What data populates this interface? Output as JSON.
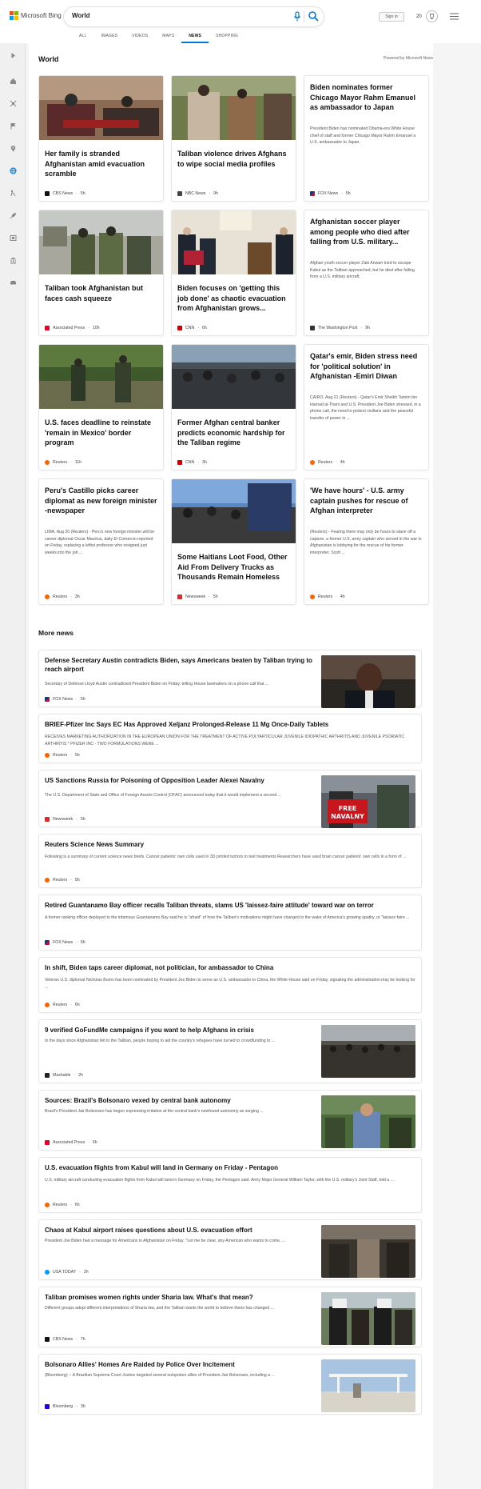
{
  "header": {
    "logo_text": "Microsoft Bing",
    "search_value": "World",
    "tabs": [
      "ALL",
      "IMAGES",
      "VIDEOS",
      "MAPS",
      "NEWS",
      "SHOPPING"
    ],
    "active_tab": "NEWS",
    "signin_label": "Sign in",
    "rewards_count": "20"
  },
  "section": {
    "title": "World",
    "powered_by": "Powered by Microsoft News"
  },
  "cards": [
    {
      "title": "Her family is stranded Afghanistan amid evacuation scramble",
      "source": "CBS News",
      "time": "5h",
      "has_image": true
    },
    {
      "title": "Taliban violence drives Afghans to wipe social media profiles",
      "source": "NBC News",
      "time": "9h",
      "has_image": true
    },
    {
      "title": "Biden nominates former Chicago Mayor Rahm Emanuel as ambassador to Japan",
      "desc": "President Biden has nominated Obama-era White House chief of staff and former Chicago Mayor Rahm Emanuel a U.S. ambassador to Japan.",
      "source": "FOX News",
      "time": "5h",
      "has_image": false
    },
    {
      "title": "Taliban took Afghanistan but faces cash squeeze",
      "source": "Associated Press",
      "time": "10h",
      "has_image": true
    },
    {
      "title": "Biden focuses on 'getting this job done' as chaotic evacuation from Afghanistan grows...",
      "source": "CNN",
      "time": "6h",
      "has_image": true
    },
    {
      "title": "Afghanistan soccer player among people who died after falling from U.S. military...",
      "desc": "Afghan youth soccer player Zaki Anwari tried to escape Kabul as the Taliban approached, but he died after falling from a U.S. military aircraft.",
      "source": "The Washington Post",
      "time": "9h",
      "has_image": false
    },
    {
      "title": "U.S. faces deadline to reinstate 'remain in Mexico' border program",
      "source": "Reuters",
      "time": "11h",
      "has_image": true
    },
    {
      "title": "Former Afghan central banker predicts economic hardship for the Taliban regime",
      "source": "CNN",
      "time": "3h",
      "has_image": true
    },
    {
      "title": "Qatar's emir, Biden stress need for 'political solution' in Afghanistan -Emiri Diwan",
      "desc": "CAIRO, Aug 21 (Reuters) - Qatar's Emir Sheikh Tamim bin Hamad al-Thani and U.S. President Joe Biden stressed, in a phone call, the need to protect civilians and the peaceful transfer of power in ...",
      "source": "Reuters",
      "time": "4h",
      "has_image": false
    },
    {
      "title": "Peru's Castillo picks career diplomat as new foreign minister -newspaper",
      "desc": "LIMA, Aug 20 (Reuters) - Peru's new foreign minister will be career diplomat Oscar Maurtua, daily El Comercio reported on Friday, replacing a leftist professor who resigned just weeks into the job ...",
      "source": "Reuters",
      "time": "3h",
      "has_image": false
    },
    {
      "title": "Some Haitians Loot Food, Other Aid From Delivery Trucks as Thousands Remain Homeless",
      "source": "Newsweek",
      "time": "5h",
      "has_image": true
    },
    {
      "title": "'We have hours' - U.S. army captain pushes for rescue of Afghan interpreter",
      "desc": "(Reuters) - Fearing there may only be hours to stave off a capture, a former U.S. army captain who served in the war in Afghanistan is lobbying for the rescue of his former interpreter.     Scott ...",
      "source": "Reuters",
      "time": "4h",
      "has_image": false
    }
  ],
  "more_news": {
    "title": "More news",
    "items": [
      {
        "title": "Defense Secretary Austin contradicts Biden, says Americans beaten by Taliban trying to reach airport",
        "desc": "Secretary of Defense Lloyd Austin contradicted President Biden on Friday, telling House lawmakers on a phone call that ...",
        "source": "FOX News",
        "time": "5h",
        "has_image": true
      },
      {
        "title": "BRIEF-Pfizer Inc Says EC Has Approved Xeljanz Prolonged-Release 11 Mg Once-Daily Tablets",
        "desc": "RECEIVES MARKETING AUTHORIZATION IN THE EUROPEAN UNION FOR THE TREATMENT OF ACTIVE POLYARTICULAR JUVENILE IDIOPATHIC ARTHRITIS AND JUVENILE PSORIATIC ARTHRITIS * PFIZER INC - TWO FORMULATIONS WERE ...",
        "source": "Reuters",
        "time": "5h",
        "has_image": false
      },
      {
        "title": "US Sanctions Russia for Poisoning of Opposition Leader Alexei Navalny",
        "desc": "The U.S. Department of State and Office of Foreign Assets Control (OFAC) announced today that it would implement a second ...",
        "source": "Newsweek",
        "time": "5h",
        "has_image": true,
        "image_text": "FREE NAVALNY"
      },
      {
        "title": "Reuters Science News Summary",
        "desc": "Following is a summary of current science news briefs. Cancer patients' own cells used in 3D printed tumors to test treatments Researchers have used brain cancer patients' own cells in a form of ...",
        "source": "Reuters",
        "time": "5h",
        "has_image": false
      },
      {
        "title": "Retired Guantanamo Bay officer recalls Taliban threats, slams US 'laissez-faire attitude' toward war on terror",
        "desc": "A former ranking officer deployed to the infamous Guantanamo Bay said he is \"afraid\" of how the Taliban's motivations might have changed in the wake of America's growing apathy, or \"laissez-faire ...",
        "source": "FOX News",
        "time": "6h",
        "has_image": false
      },
      {
        "title": "In shift, Biden taps career diplomat, not politician, for ambassador to China",
        "desc": "Veteran U.S. diplomat Nicholas Burns has been nominated by President Joe Biden to serve as U.S. ambassador to China, the White House said on Friday, signaling the administration may be looking for ...",
        "source": "Reuters",
        "time": "6h",
        "has_image": false
      },
      {
        "title": "9 verified GoFundMe campaigns if you want to help Afghans in crisis",
        "desc": "In the days since Afghanistan fell to the Taliban, people hoping to aid the country's refugees have turned to crowdfunding to ...",
        "source": "Mashable",
        "time": "2h",
        "has_image": true
      },
      {
        "title": "Sources: Brazil's Bolsonaro vexed by central bank autonomy",
        "desc": "Brazil's President Jair Bolsonaro has begun expressing irritation at the central bank's newfound autonomy as surging ...",
        "source": "Associated Press",
        "time": "6h",
        "has_image": true
      },
      {
        "title": "U.S. evacuation flights from Kabul will land in Germany on Friday - Pentagon",
        "desc": "U.S. military aircraft conducting evacuation flights from Kabul will land in Germany on Friday, the Pentagon said. Army Major General William Taylor, with the U.S. military's Joint Staff, told a ...",
        "source": "Reuters",
        "time": "6h",
        "has_image": false
      },
      {
        "title": "Chaos at Kabul airport raises questions about U.S. evacuation effort",
        "desc": "President Joe Biden had a message for Americans in Afghanistan on Friday: \"Let me be clear, any American who wants to come, ...",
        "source": "USA TODAY",
        "time": "2h",
        "has_image": true
      },
      {
        "title": "Taliban promises women rights under Sharia law. What's that mean?",
        "desc": "Different groups adopt different interpretations of Sharia law, and the Taliban wants the world to believe theirs has changed ...",
        "source": "CBS News",
        "time": "7h",
        "has_image": true
      },
      {
        "title": "Bolsonaro Allies' Homes Are Raided by Police Over Incitement",
        "desc": "(Bloomberg) -- A Brazilian Supreme Court Justice targeted several outspoken allies of President Jair Bolsonaro, including a ...",
        "source": "Bloomberg",
        "time": "3h",
        "has_image": true
      }
    ]
  },
  "colors": {
    "accent": "#0078d4",
    "logo_red": "#f25022",
    "logo_green": "#7fba00",
    "logo_blue": "#00a4ef",
    "logo_yellow": "#ffb900"
  }
}
